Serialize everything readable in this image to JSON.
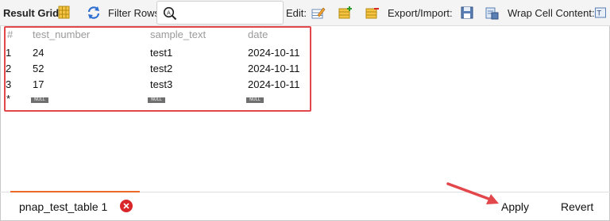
{
  "toolbar": {
    "result_grid_label": "Result Grid",
    "filter_rows_label": "Filter Rows:",
    "filter_value": "",
    "edit_label": "Edit:",
    "export_import_label": "Export/Import:",
    "wrap_cell_label": "Wrap Cell Content:"
  },
  "grid": {
    "columns": [
      "#",
      "test_number",
      "sample_text",
      "date"
    ],
    "rows": [
      {
        "num": "1",
        "test_number": "24",
        "sample_text": "test1",
        "date": "2024-10-11"
      },
      {
        "num": "2",
        "test_number": "52",
        "sample_text": "test2",
        "date": "2024-10-11"
      },
      {
        "num": "3",
        "test_number": "17",
        "sample_text": "test3",
        "date": "2024-10-11"
      }
    ],
    "new_row_marker": "*",
    "null_label": "NULL"
  },
  "bottom": {
    "tab_label": "pnap_test_table 1",
    "apply_label": "Apply",
    "revert_label": "Revert"
  },
  "colors": {
    "highlight_border": "#e2474b",
    "tab_accent": "#ea6a2a",
    "close_red": "#d9262b",
    "arrow_red": "#e2474b"
  }
}
